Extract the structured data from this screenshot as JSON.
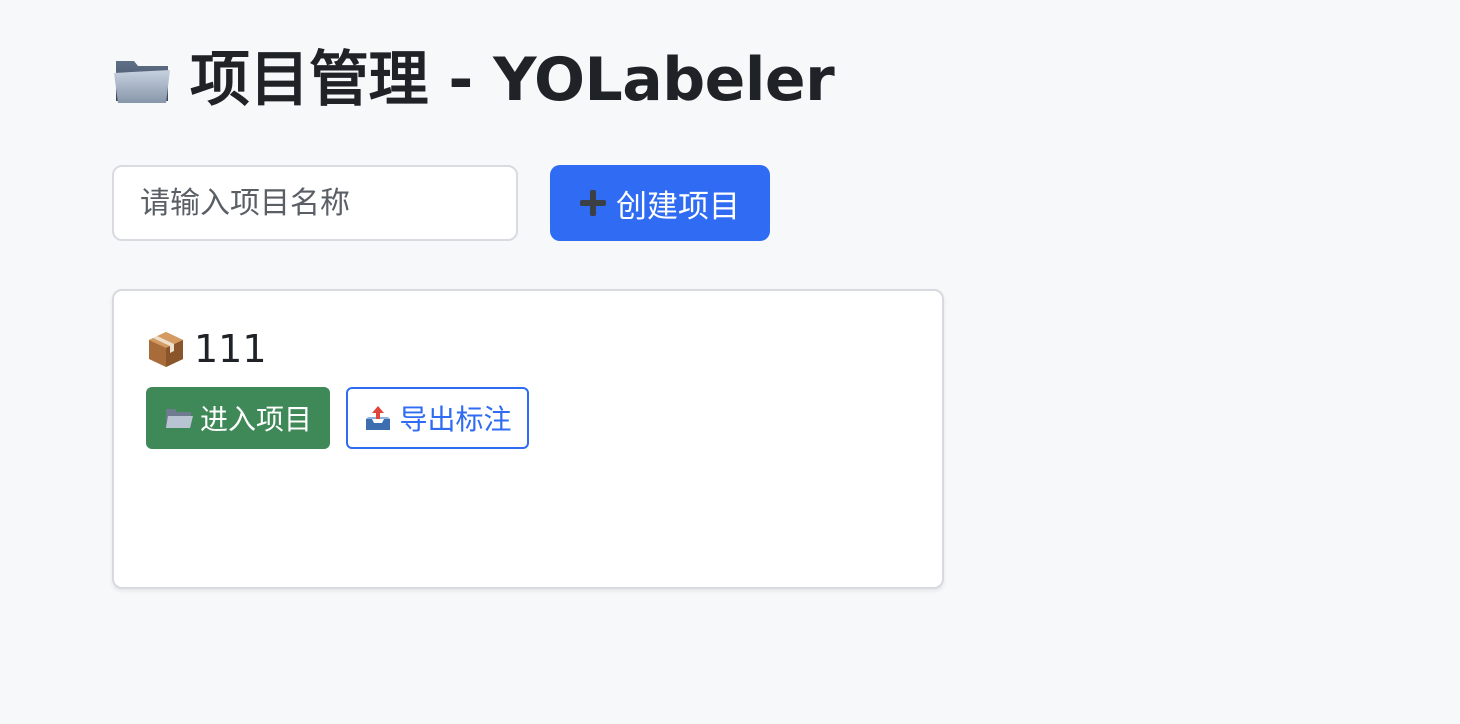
{
  "header": {
    "title": "项目管理 - YOLabeler",
    "title_icon": "folder-icon"
  },
  "toolbar": {
    "project_name_placeholder": "请输入项目名称",
    "project_name_value": "",
    "create_label": "创建项目",
    "create_icon": "plus-icon"
  },
  "projects": [
    {
      "name": "111",
      "icon": "package-icon",
      "enter_label": "进入项目",
      "enter_icon": "open-folder-icon",
      "export_label": "导出标注",
      "export_icon": "outbox-tray-icon"
    }
  ],
  "colors": {
    "background": "#f7f8fa",
    "primary": "#2f6cf3",
    "success": "#3f8858",
    "text": "#1f2328"
  }
}
